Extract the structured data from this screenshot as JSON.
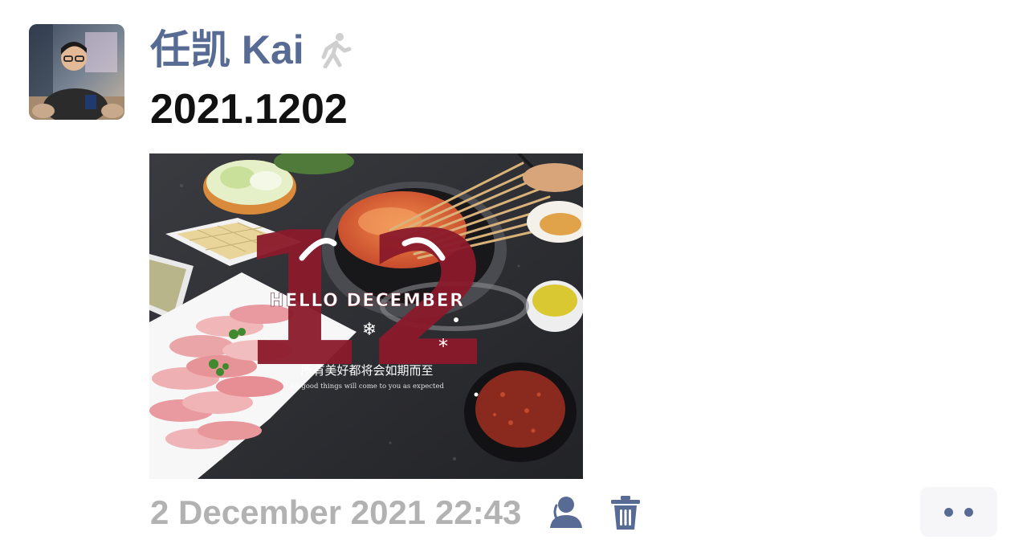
{
  "author": {
    "name": "任凯 Kai",
    "avatar_icon": "profile-photo",
    "status_icon": "walking-person-icon"
  },
  "post": {
    "text": "2021.1202",
    "image": {
      "overlay_number": "12",
      "overlay_title": "HELLO DECEMBER",
      "overlay_caption_cn": "所有美好都将会如期而至",
      "overlay_caption_en": "All good things will come to you as expected"
    }
  },
  "meta": {
    "timestamp": "2 December 2021 22:43",
    "visibility_icon": "person-icon",
    "delete_icon": "trash-icon",
    "more_icon": "two-dots-icon"
  },
  "colors": {
    "name_blue": "#576b95",
    "timestamp_gray": "#b2b2b2",
    "icon_blue": "#576b95",
    "overlay_red": "#8b1a2b"
  }
}
